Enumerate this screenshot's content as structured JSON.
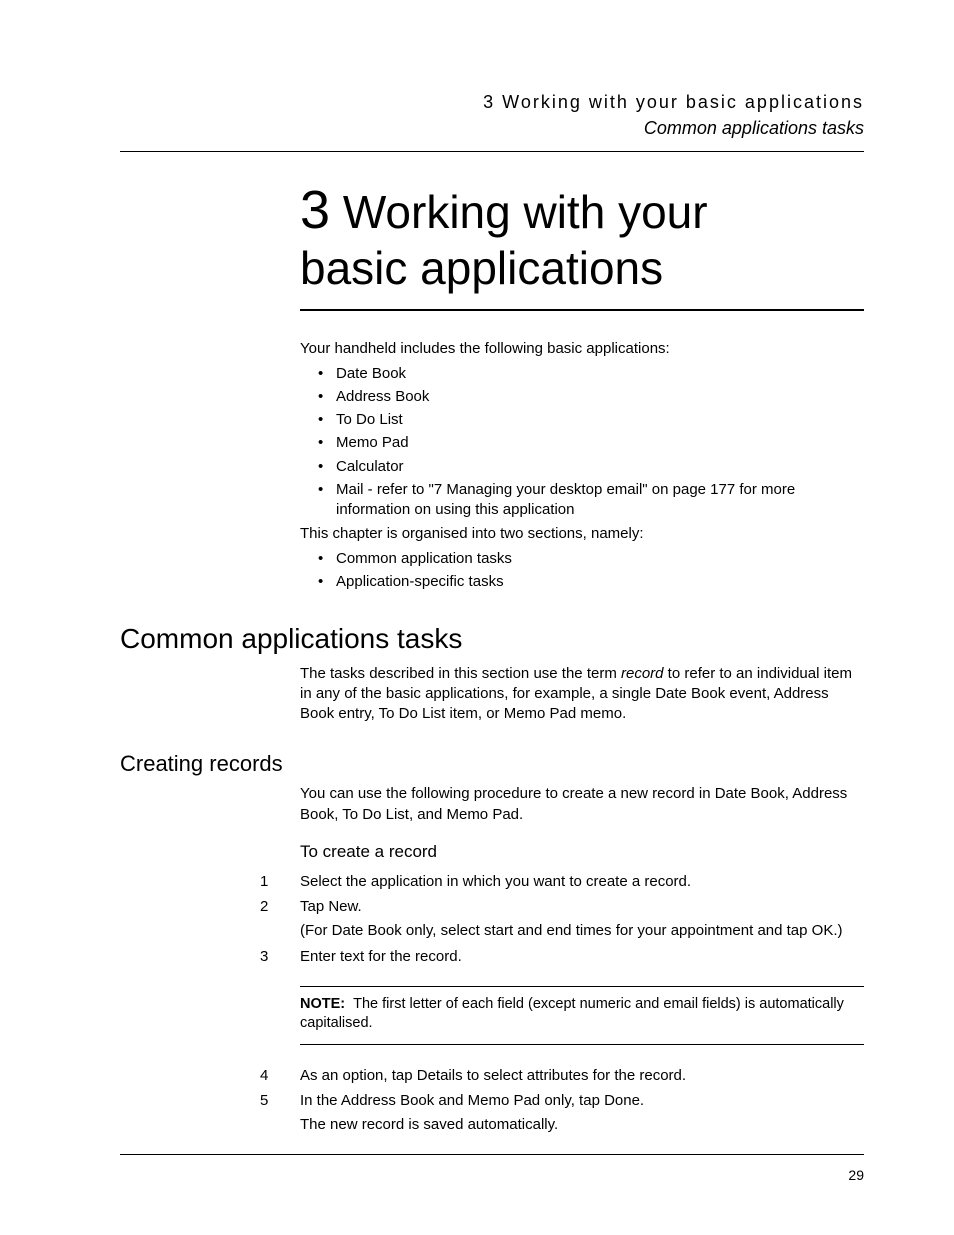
{
  "header": {
    "chapter_running": "3 Working with your basic applications",
    "section_running": "Common applications tasks"
  },
  "chapter": {
    "number": "3",
    "title_line1": " Working with your",
    "title_line2": "basic applications"
  },
  "intro": {
    "lead": "Your handheld includes the following basic applications:",
    "apps": [
      "Date Book",
      "Address Book",
      "To Do List",
      "Memo Pad",
      "Calculator",
      "Mail - refer to \"7 Managing your desktop email\" on page 177 for more information on using this application"
    ],
    "organise": "This chapter is organised into two sections, namely:",
    "sections": [
      "Common application tasks",
      "Application-specific tasks"
    ]
  },
  "common_tasks": {
    "heading": "Common applications tasks",
    "para_pre": "The tasks described in this section use the term ",
    "term": "record",
    "para_post": " to refer to an individual item in any of the basic applications, for example, a single Date Book event, Address Book entry, To Do List item, or Memo Pad memo."
  },
  "creating_records": {
    "heading": "Creating records",
    "para": "You can use the following procedure to create a new record in Date Book, Address Book, To Do List, and Memo Pad.",
    "proc_heading": "To create a record",
    "steps": [
      {
        "n": "1",
        "text": "Select the application in which you want to create a record."
      },
      {
        "n": "2",
        "text": "Tap New.",
        "sub": "(For Date Book only, select start and end times for your appointment and tap OK.)"
      },
      {
        "n": "3",
        "text": "Enter text for the record."
      }
    ],
    "note_label": "NOTE:",
    "note_text": "The first letter of each field (except numeric and email fields) is automatically capitalised.",
    "steps_after": [
      {
        "n": "4",
        "text": "As an option, tap Details to select attributes for the record."
      },
      {
        "n": "5",
        "text": "In the Address Book and Memo Pad only, tap Done.",
        "sub": "The new record is saved automatically."
      }
    ]
  },
  "footer": {
    "page_number": "29"
  }
}
